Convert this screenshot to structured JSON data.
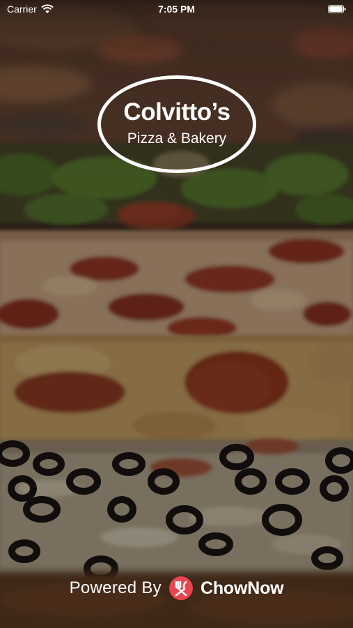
{
  "status_bar": {
    "carrier": "Carrier",
    "time": "7:05 PM",
    "wifi_icon": "wifi-icon",
    "battery_icon": "battery-icon"
  },
  "logo": {
    "title": "Colvitto’s",
    "subtitle": "Pizza & Bakery"
  },
  "footer": {
    "powered_by": "Powered By",
    "brand_name": "ChowNow",
    "brand_icon": "chownow-fork-icon",
    "brand_color": "#e8454f"
  },
  "background": {
    "image": "pizza-background",
    "overlay_color": "#000000"
  }
}
